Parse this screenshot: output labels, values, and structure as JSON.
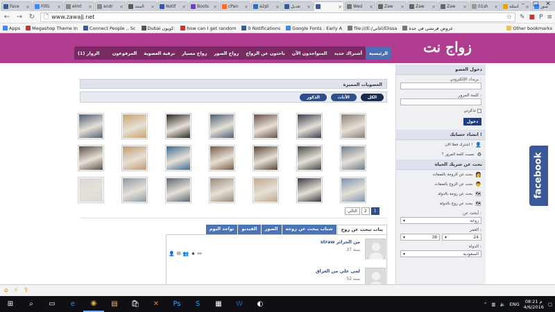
{
  "browser": {
    "tabs": [
      {
        "title": "Face",
        "color": "#3b5998"
      },
      {
        "title": "FillG",
        "color": "#4285f4"
      },
      {
        "title": "elmt",
        "color": "#888888"
      },
      {
        "title": "andr",
        "color": "#8a8a8a"
      },
      {
        "title": "المنتد",
        "color": "#5a5a5a"
      },
      {
        "title": "Notif",
        "color": "#3b5998"
      },
      {
        "title": "Boots",
        "color": "#6f42c1"
      },
      {
        "title": "cPan",
        "color": "#ff6c2c"
      },
      {
        "title": "a2pl",
        "color": "#2d6fc1"
      },
      {
        "title": "تعديل",
        "color": "#3b5998"
      },
      {
        "title": "",
        "color": "#3b5998"
      },
      {
        "title": "Wed",
        "color": "#777777"
      },
      {
        "title": "Zaw",
        "color": "#666666"
      },
      {
        "title": "Zaw",
        "color": "#666666"
      },
      {
        "title": "Zaw",
        "color": "#666666"
      },
      {
        "title": "01sh",
        "color": "#999999"
      },
      {
        "title": "أسئلة",
        "color": "#f0a000"
      },
      {
        "title": "صور",
        "color": "#4285f4"
      }
    ],
    "active_tab": 10,
    "url": "www.zawajj.net",
    "bookmarks": [
      {
        "label": "Apps",
        "color": "#4285f4"
      },
      {
        "label": "Megashop Theme In",
        "color": "#cc3333"
      },
      {
        "label": "Connect People .. Sc",
        "color": "#3b5998"
      },
      {
        "label": "Dubai كوبون:",
        "color": "#555555"
      },
      {
        "label": "how can I get random",
        "color": "#cc3333"
      },
      {
        "label": "0 Notifications",
        "color": "#3b5998"
      },
      {
        "label": "Google Fonts : Early A",
        "color": "#4285f4"
      },
      {
        "label": "file:///E:/اغاني/Elissa",
        "color": "#777777"
      },
      {
        "label": "عروض فرنشي في جدة",
        "color": "#777777"
      }
    ],
    "other_bookmarks": "Other bookmarks"
  },
  "site": {
    "logo": "زواج نت",
    "nav": [
      "الرئيسية",
      "أشتراك جديد",
      "المتواجدون الآن",
      "باحثون عن الزواج",
      "زواج الصور",
      "زواج مسيار",
      "ترقية العضوية",
      "المرفوعون"
    ],
    "visitors": "الزوار (1)"
  },
  "sidebar": {
    "login_title": "دخول العضو",
    "email_label": "بريدك الإلكتروني :",
    "password_label": "كلمة المرور :",
    "remember_label": "تذكرني",
    "login_button": "دخول",
    "create_title": "انشاء حسابك !",
    "create_links": [
      {
        "icon": "👤",
        "text": "اشترك فعلا الان !"
      },
      {
        "icon": "♻",
        "text": "نسيت كلمة المرور ؟"
      }
    ],
    "search_title": "بحث عن شريك الحياة",
    "search_links": [
      {
        "icon": "👩",
        "text": "بحث عن الزوجة بالصفات"
      },
      {
        "icon": "👨",
        "text": "بحث عن الزوج بالصفات"
      },
      {
        "icon": "🗺",
        "text": "بحث عن زوجة بالدولة"
      },
      {
        "icon": "🗺",
        "text": "بحث عن زوج بالدولة"
      }
    ],
    "looking_label": "أبحث عن :",
    "looking_value": "زوجة",
    "age_label": "العمر :",
    "age_from": "24",
    "age_to": "38",
    "country_label": "الدولة :",
    "country_value": "السعودية"
  },
  "content": {
    "featured_title": "العضويات المميزة",
    "filters": [
      "الكل",
      "الأناث",
      "الذكور"
    ],
    "active_filter": 0,
    "photos": [
      {
        "color": "#8a7d74"
      },
      {
        "color": "#3d3f52"
      },
      {
        "color": "#6b5148"
      },
      {
        "color": "#4f5f7a"
      },
      {
        "color": "#2d2a2a"
      },
      {
        "color": "#c8a46a"
      },
      {
        "color": "#4e6074"
      },
      {
        "color": "#6c7c8e"
      },
      {
        "color": "#474747"
      },
      {
        "color": "#5a4638"
      },
      {
        "color": "#7b5a44"
      },
      {
        "color": "#3e6a8e"
      },
      {
        "color": "#c09a72"
      },
      {
        "color": "#5d5048"
      },
      {
        "color": "#7e93b0"
      },
      {
        "color": "#3a3a40"
      },
      {
        "color": "#bfa98c"
      },
      {
        "color": "#9a8a7a"
      },
      {
        "color": "#5b6775"
      },
      {
        "color": "#8c9aa6"
      },
      {
        "color": "#d9d9d9"
      }
    ],
    "pager": {
      "pages": [
        "1",
        "2"
      ],
      "current": 0,
      "next": "التالي"
    },
    "tabs": [
      "بنات تبحث عن زوج",
      "شباب يبحث عن زوجه",
      "الصور",
      "الفيديو",
      "تواجد اليوم"
    ],
    "active_tab": 0,
    "members": [
      {
        "name": "straw من الجزائر",
        "age": "37 سنة"
      },
      {
        "name": "لمى علي من العراق",
        "age": "52 سنة"
      }
    ]
  },
  "facebook_label": "facebook",
  "taskbar": {
    "lang": "ENG",
    "time": "08:21 م",
    "date": "4/6/2016"
  }
}
